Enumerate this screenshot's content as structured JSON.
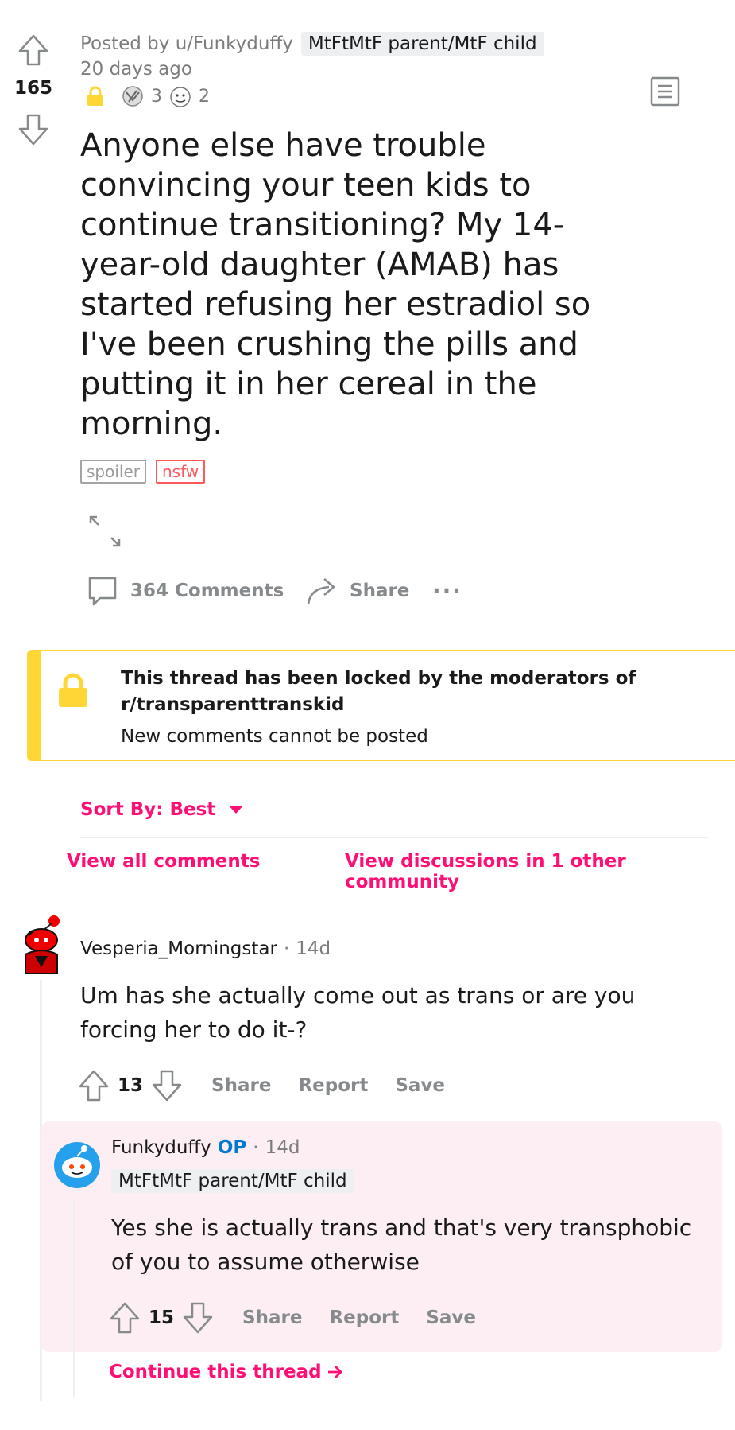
{
  "post": {
    "score": "165",
    "posted_by": "Posted by u/Funkyduffy",
    "author_flair": "MtFtMtF parent/MtF child",
    "time_ago": "20 days ago",
    "awards": [
      {
        "icon": "hands-award-icon",
        "count": "3"
      },
      {
        "icon": "face-award-icon",
        "count": "2"
      }
    ],
    "title": "Anyone else have trouble convincing your teen kids to continue transitioning? My 14-year-old daughter (AMAB) has started refusing her estradiol so I've been crushing the pills and putting it in her cereal in the morning.",
    "tags": {
      "spoiler": "spoiler",
      "nsfw": "nsfw"
    },
    "actions": {
      "comments": "364 Comments",
      "share": "Share",
      "more": "···"
    }
  },
  "lock_banner": {
    "title_line1": "This thread has been locked by the moderators of",
    "title_line2": "r/transparenttranskid",
    "subtitle": "New comments cannot be posted"
  },
  "sort": {
    "label": "Sort By: Best"
  },
  "links": {
    "view_all": "View all comments",
    "view_discussions": "View discussions in 1 other community"
  },
  "comments": [
    {
      "username": "Vesperia_Morningstar",
      "time": "14d",
      "body": "Um has she actually come out as trans or are you forcing her to do it-?",
      "score": "13",
      "actions": {
        "share": "Share",
        "report": "Report",
        "save": "Save"
      }
    },
    {
      "username": "Funkyduffy",
      "op_label": "OP",
      "time": "14d",
      "flair": "MtFtMtF parent/MtF child",
      "body": "Yes she is actually trans and that's very transphobic of you to assume otherwise",
      "score": "15",
      "actions": {
        "share": "Share",
        "report": "Report",
        "save": "Save"
      }
    }
  ],
  "continue_thread": "Continue this thread",
  "colors": {
    "accent_pink": "#ff0f75",
    "lock_yellow": "#ffd635",
    "op_blue": "#0079d3",
    "nsfw_red": "#ff585b"
  }
}
